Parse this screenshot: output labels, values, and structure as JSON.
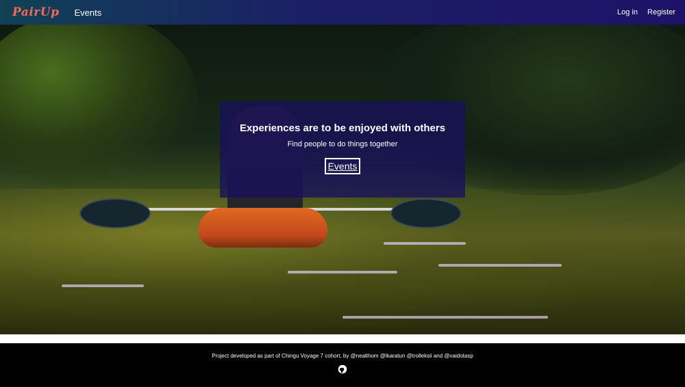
{
  "navbar": {
    "brand": "PairUp",
    "events_link": "Events",
    "login_link": "Log in",
    "register_link": "Register"
  },
  "hero": {
    "title": "Experiences are to be enjoyed with others",
    "subtitle": "Find people to do things together",
    "button_label": "Events"
  },
  "footer": {
    "text": "Project developed as part of Chingu Voyage 7 cohort, by @nealthom @lkaratun @trolleksii and @vaidotasp",
    "icon": "github-icon"
  },
  "colors": {
    "brand": "#f26b5b",
    "navbar_start": "#114155",
    "navbar_end": "#1d1268",
    "card": "#18105c",
    "footer_bg": "#000000"
  }
}
